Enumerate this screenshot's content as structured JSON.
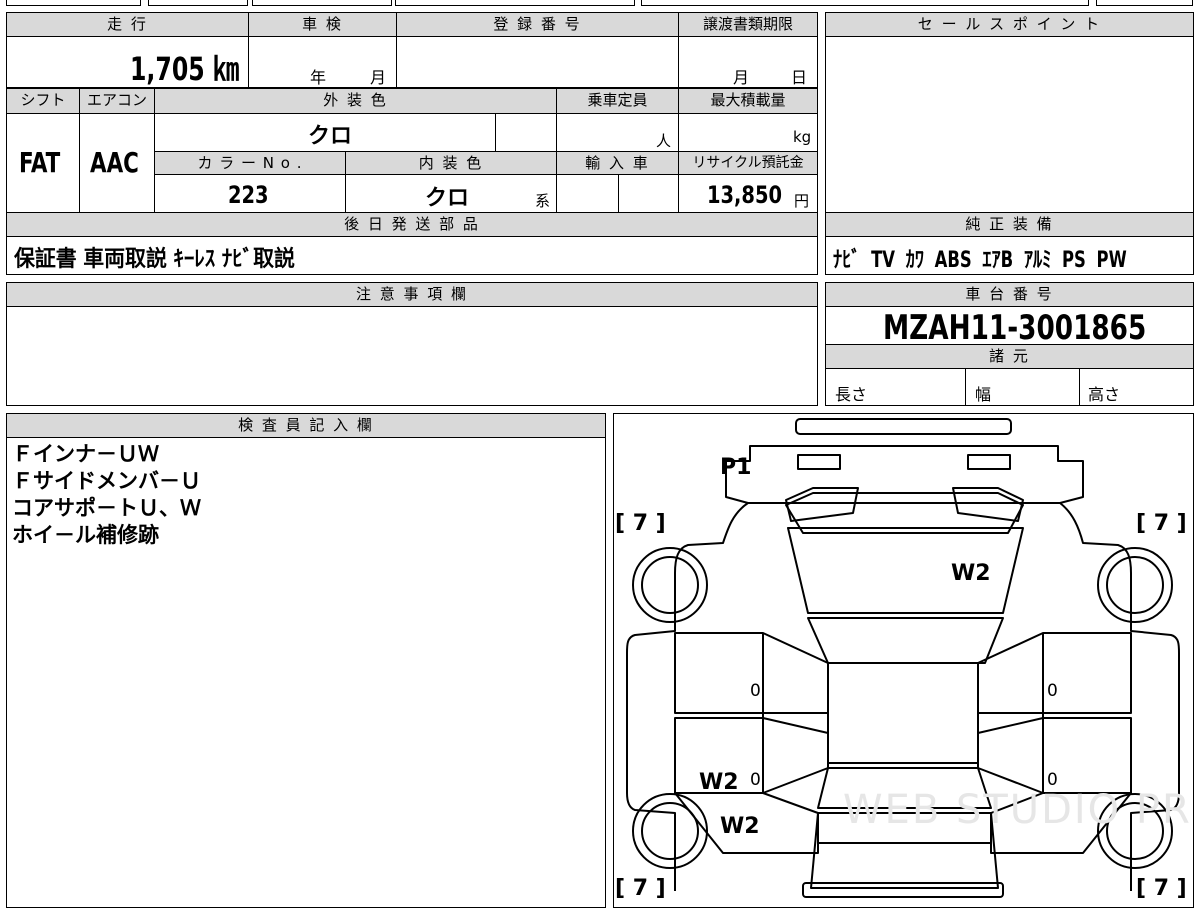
{
  "fields": {
    "mileage": {
      "label": "走 行",
      "value": "1,705 ㎞"
    },
    "inspection": {
      "label": "車 検",
      "year_unit": "年",
      "month_unit": "月"
    },
    "registration": {
      "label": "登 録 番 号"
    },
    "transfer_deadline": {
      "label": "譲渡書類期限",
      "month_unit": "月",
      "day_unit": "日"
    },
    "shift": {
      "label": "シフト",
      "value": "FAT"
    },
    "aircon": {
      "label": "エアコン",
      "value": "AAC"
    },
    "exterior_color": {
      "label": "外 装 色",
      "value": "クロ"
    },
    "capacity": {
      "label": "乗車定員",
      "unit": "人"
    },
    "max_load": {
      "label": "最大積載量",
      "unit": "kg"
    },
    "color_no": {
      "label": "カ ラ ー N o .",
      "value": "223"
    },
    "interior_color": {
      "label": "内 装 色",
      "value": "クロ",
      "suffix": "系"
    },
    "import": {
      "label": "輸 入 車"
    },
    "recycle_fee": {
      "label": "リサイクル預託金",
      "value": "13,850",
      "unit": "円"
    },
    "later_items": {
      "label": "後 日 発 送 部 品",
      "value": "保証書 車両取説 ｷｰﾚｽ ﾅﾋﾞ取説"
    },
    "sales_point": {
      "label": "セ ー ル ス ポ イ ン ト"
    },
    "genuine_equipment": {
      "label": "純 正 装 備",
      "value": "ﾅﾋﾞ TV ｶﾜ ABS ｴｱB ｱﾙﾐ PS PW"
    },
    "notes": {
      "label": "注 意 事 項 欄"
    },
    "chassis_no": {
      "label": "車 台 番 号",
      "value": "MZAH11-3001865"
    },
    "specs": {
      "label": "諸 元",
      "length": "長さ",
      "width": "幅",
      "height": "高さ"
    },
    "inspector": {
      "label": "検 査 員 記 入 欄",
      "lines": [
        "Ｆインナ－ＵＷ",
        "Ｆサイドメンバ－Ｕ",
        "コアサポ－トＵ、Ｗ",
        "ホイ－ル補修跡"
      ]
    }
  },
  "diagram": {
    "marks": {
      "p1": "P1",
      "w2_hood": "W2",
      "w2_door": "W2",
      "w2_rear": "W2",
      "zero_a": "0",
      "zero_b": "0",
      "zero_c": "0",
      "zero_d": "0",
      "tire_tl": "[ 7 ]",
      "tire_tr": "[ 7 ]",
      "tire_bl": "[ 7 ]",
      "tire_br": "[ 7 ]"
    },
    "watermark": "WEB STUDIO PRO"
  }
}
